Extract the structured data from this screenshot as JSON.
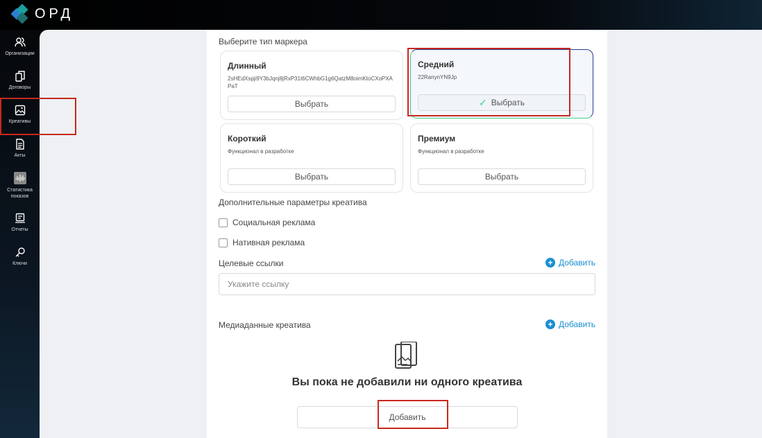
{
  "app": {
    "logo": "ОРД"
  },
  "sidebar": {
    "items": [
      {
        "label": "Организации"
      },
      {
        "label": "Договоры"
      },
      {
        "label": "Креативы"
      },
      {
        "label": "Акты"
      },
      {
        "label": "Статистика показов"
      },
      {
        "label": "Отчеты"
      },
      {
        "label": "Ключи"
      }
    ]
  },
  "marker": {
    "title": "Выберите тип маркера",
    "cards": [
      {
        "title": "Длинный",
        "sub": "2sHEdXspji9Y3bJqnj8jRxP31t6CWhbG1g6QatzM8oimKtoCXoPXAPaT",
        "button": "Выбрать",
        "selected": false
      },
      {
        "title": "Средний",
        "sub": "22RanynYN9Jp",
        "button": "Выбрать",
        "selected": true
      },
      {
        "title": "Короткий",
        "sub": "Функционал в разработке",
        "button": "Выбрать",
        "selected": false
      },
      {
        "title": "Премиум",
        "sub": "Функционал в разработке",
        "button": "Выбрать",
        "selected": false
      }
    ]
  },
  "extra": {
    "title": "Дополнительные параметры креатива",
    "social": "Социальная реклама",
    "native": "Нативная реклама"
  },
  "links": {
    "title": "Целевые ссылки",
    "add": "Добавить",
    "placeholder": "Укажите ссылку"
  },
  "media": {
    "title": "Медиаданные креатива",
    "add": "Добавить",
    "empty": "Вы пока не добавили ни одного креатива",
    "button": "Добавить"
  },
  "colors": {
    "accent": "#1a8fd0",
    "active": "#3ecf8e",
    "highlight": "#c8281e"
  }
}
